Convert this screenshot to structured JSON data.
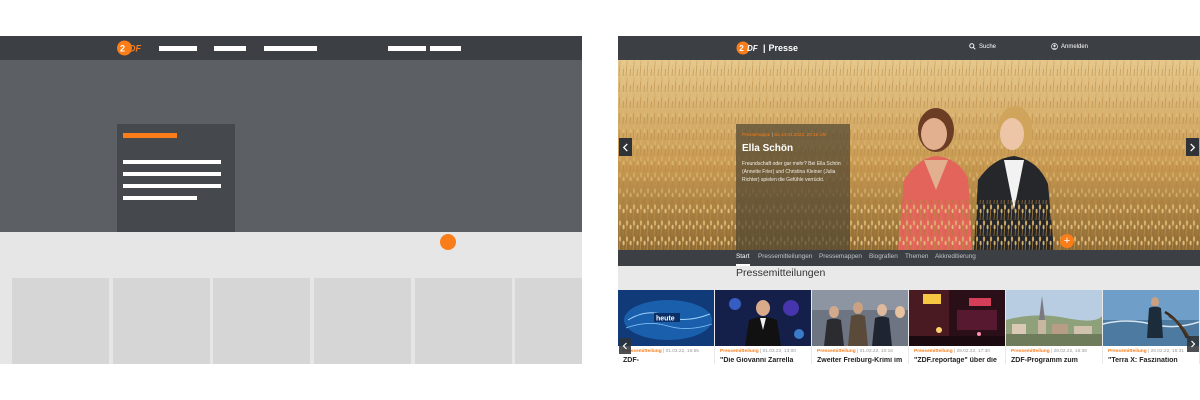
{
  "colors": {
    "accent": "#fa7d19",
    "nav_bg": "#3c4045",
    "page_bg": "#e9e9e9"
  },
  "wireframe": {
    "logo_icon": "zdf-logo-icon",
    "nav_bar_count": 5,
    "tile_count": 6
  },
  "site": {
    "logo_icon": "zdf-logo-icon",
    "brand_separator": "|",
    "brand_name": "Presse",
    "search_label": "Suche",
    "search_icon": "search-icon",
    "login_label": "Anmelden",
    "login_icon": "user-icon"
  },
  "hero": {
    "kicker_kind": "Pressemappe",
    "kicker_date": "Sa 14.04.2022, 20:15 Uhr",
    "title": "Ella Schön",
    "text": "Freundschaft oder gar mehr? Bei Ella Schön (Annette Frier) und Christina Kleiner (Julia Richter) spielen die Gefühle verrückt.",
    "prev_icon": "chevron-left-icon",
    "next_icon": "chevron-right-icon",
    "more_symbol": "+"
  },
  "tabs": [
    {
      "label": "Start",
      "active": true
    },
    {
      "label": "Pressemitteilungen",
      "active": false
    },
    {
      "label": "Pressemappen",
      "active": false
    },
    {
      "label": "Biografien",
      "active": false
    },
    {
      "label": "Themen",
      "active": false
    },
    {
      "label": "Akkreditierung",
      "active": false
    }
  ],
  "section": {
    "title": "Pressemitteilungen"
  },
  "teasers": [
    {
      "kind": "Pressemitteilung",
      "date": "01.03.22, 16:55",
      "headline": "ZDF-",
      "thumb_label": "heute"
    },
    {
      "kind": "Pressemitteilung",
      "date": "01.03.22, 13:00",
      "headline": "\"Die Giovanni Zarrella",
      "thumb_label": ""
    },
    {
      "kind": "Pressemitteilung",
      "date": "01.03.22, 10:16",
      "headline": "Zweiter Freiburg-Krimi im",
      "thumb_label": ""
    },
    {
      "kind": "Pressemitteilung",
      "date": "28.02.22, 17:30",
      "headline": "\"ZDF.reportage\" über die",
      "thumb_label": ""
    },
    {
      "kind": "Pressemitteilung",
      "date": "28.02.22, 16:36",
      "headline": "ZDF-Programm zum",
      "thumb_label": ""
    },
    {
      "kind": "Pressemitteilung",
      "date": "28.02.22, 15:31",
      "headline": "\"Terra X: Faszination",
      "thumb_label": ""
    }
  ]
}
